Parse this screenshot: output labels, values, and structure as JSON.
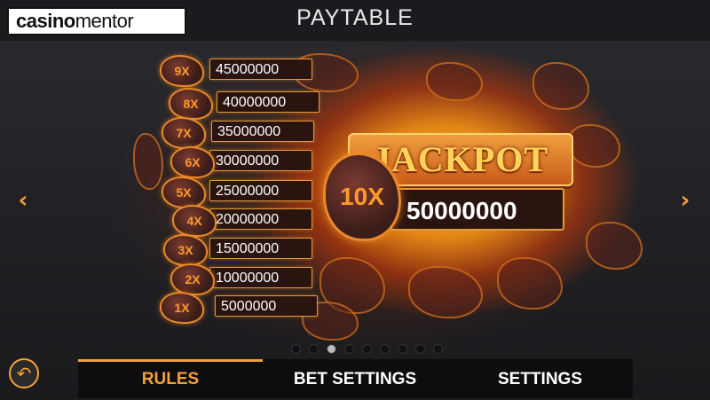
{
  "header": {
    "logo_part1": "casino",
    "logo_part2": "mentor",
    "title": "PAYTABLE"
  },
  "paytable": [
    {
      "multiplier": "9X",
      "amount": "45000000"
    },
    {
      "multiplier": "8X",
      "amount": "40000000"
    },
    {
      "multiplier": "7X",
      "amount": "35000000"
    },
    {
      "multiplier": "6X",
      "amount": "30000000"
    },
    {
      "multiplier": "5X",
      "amount": "25000000"
    },
    {
      "multiplier": "4X",
      "amount": "20000000"
    },
    {
      "multiplier": "3X",
      "amount": "15000000"
    },
    {
      "multiplier": "2X",
      "amount": "10000000"
    },
    {
      "multiplier": "1X",
      "amount": "5000000"
    }
  ],
  "jackpot": {
    "label": "JACKPOT",
    "multiplier": "10X",
    "amount": "50000000"
  },
  "navigation": {
    "prev_icon": "chevron-left-icon",
    "next_icon": "chevron-right-icon",
    "page_count": 9,
    "active_page": 3
  },
  "footer": {
    "back_icon": "back-arrow-icon",
    "tabs": [
      {
        "label": "RULES",
        "active": true
      },
      {
        "label": "BET SETTINGS",
        "active": false
      },
      {
        "label": "SETTINGS",
        "active": false
      }
    ]
  },
  "colors": {
    "accent": "#f3a23a",
    "background": "#1c1c1f",
    "panel": "#2a1410"
  }
}
